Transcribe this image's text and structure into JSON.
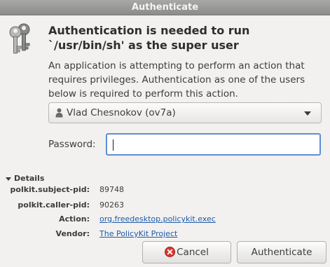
{
  "window": {
    "title": "Authenticate"
  },
  "message": {
    "heading": "Authentication is needed to run `/usr/bin/sh' as the super user",
    "description": "An application is attempting to perform an action that requires privileges. Authentication as one of the users below is required to perform this action."
  },
  "user_select": {
    "selected": "Vlad Chesnokov (ov7a)"
  },
  "password": {
    "label": "Password:",
    "value": ""
  },
  "details": {
    "header": "Details",
    "rows": [
      {
        "key": "polkit.subject-pid:",
        "value": "89748"
      },
      {
        "key": "polkit.caller-pid:",
        "value": "90263"
      },
      {
        "key": "Action:",
        "value": "org.freedesktop.policykit.exec"
      },
      {
        "key": "Vendor:",
        "value": "The PolicyKit Project"
      }
    ]
  },
  "buttons": {
    "cancel": "Cancel",
    "authenticate": "Authenticate"
  },
  "colors": {
    "titlebar": "#999997",
    "background": "#f2f1f0",
    "focus_border": "#5f8dd3",
    "link": "#1e5aa8",
    "cancel_icon": "#d9362b"
  },
  "icons": {
    "dialog": "keys-icon",
    "user": "user-icon",
    "dropdown": "chevron-down-icon",
    "details_toggle": "expander-triangle-icon",
    "cancel": "cancel-circle-icon"
  }
}
